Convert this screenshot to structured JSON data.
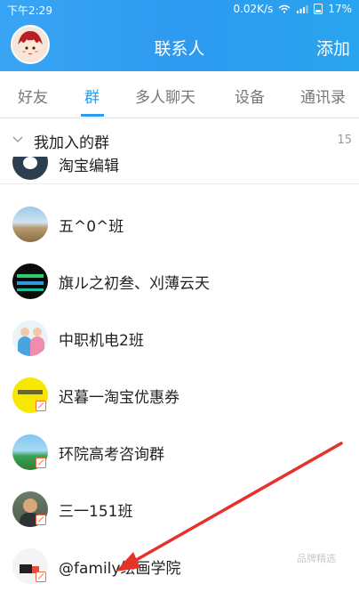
{
  "status_bar": {
    "time": "下午2:29",
    "network_speed": "0.02K/s",
    "battery": "17%",
    "icons": [
      "wifi-icon",
      "signal-icon",
      "battery-icon"
    ]
  },
  "header": {
    "title": "联系人",
    "add_label": "添加"
  },
  "tabs": [
    {
      "label": "好友",
      "active": false
    },
    {
      "label": "群",
      "active": true
    },
    {
      "label": "多人聊天",
      "active": false
    },
    {
      "label": "设备",
      "active": false
    },
    {
      "label": "通讯录",
      "active": false
    }
  ],
  "group_section": {
    "title": "我加入的群",
    "count": "15"
  },
  "groups": [
    {
      "name": "淘宝编辑"
    },
    {
      "name": "五^0^班"
    },
    {
      "name": "旗ル之初叁、刈薄云天"
    },
    {
      "name": "中职机电2班"
    },
    {
      "name": "迟暮一淘宝优惠券"
    },
    {
      "name": "环院高考咨询群"
    },
    {
      "name": "三一151班"
    },
    {
      "name": "@family绘画学院"
    }
  ],
  "watermark": "品牌精选",
  "colors": {
    "brand_blue": "#2b9cf2",
    "mute_red": "#ff6a3d",
    "annotation_arrow": "#e5332a"
  }
}
